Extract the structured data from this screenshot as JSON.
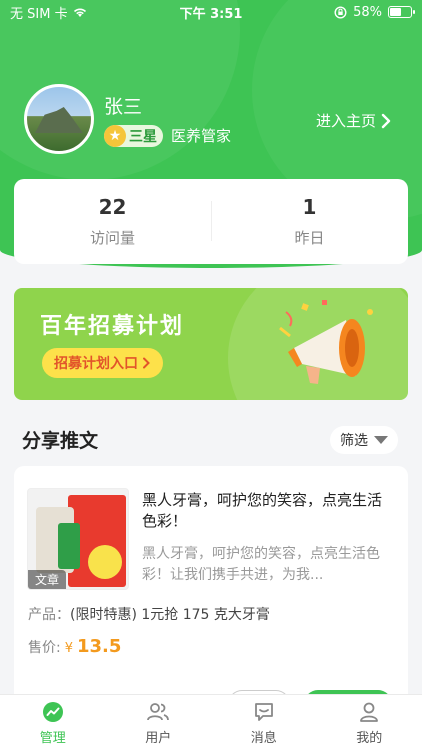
{
  "status_bar": {
    "carrier": "无 SIM 卡",
    "time": "下午 3:51",
    "battery": "58%",
    "battery_level": 0.58
  },
  "profile": {
    "name": "张三",
    "level": "三星",
    "role": "医养管家",
    "enter_home": "进入主页"
  },
  "stats": [
    {
      "value": "22",
      "label": "访问量"
    },
    {
      "value": "1",
      "label": "昨日"
    }
  ],
  "banner": {
    "title": "百年招募计划",
    "entry": "招募计划入口"
  },
  "section": {
    "title": "分享推文",
    "filter": "筛选"
  },
  "post": {
    "tag": "文章",
    "title": "黑人牙膏，呵护您的笑容，点亮生活色彩！",
    "desc": "黑人牙膏，呵护您的笑容，点亮生活色彩！让我们携手共进，为我...",
    "product_key": "产品：",
    "product_value": "(限时特惠) 1元抢 175 克大牙膏",
    "price_key": "售价:",
    "currency": "¥",
    "price": "13.5"
  },
  "tabbar": [
    {
      "label": "管理",
      "icon": "chart-icon",
      "active": true
    },
    {
      "label": "用户",
      "icon": "users-icon",
      "active": false
    },
    {
      "label": "消息",
      "icon": "message-icon",
      "active": false
    },
    {
      "label": "我的",
      "icon": "person-icon",
      "active": false
    }
  ],
  "colors": {
    "primary": "#3ec454",
    "price": "#f39a1e",
    "banner": "#8fd44c"
  }
}
